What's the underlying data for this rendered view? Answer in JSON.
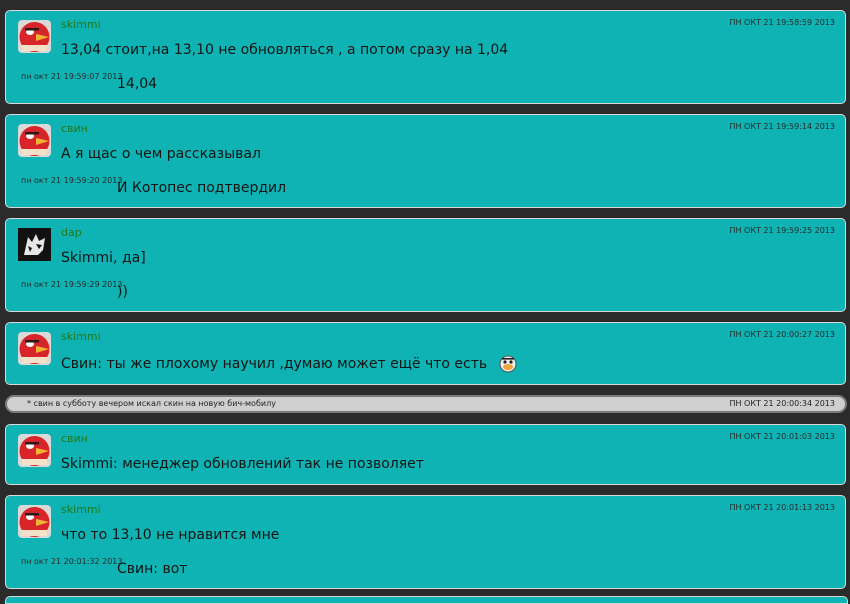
{
  "colors": {
    "card_bg": "#0fb3b3",
    "page_bg": "#2b2b2b",
    "nick": "#1f7a1f"
  },
  "messages": [
    {
      "nick": "skimmi",
      "avatar": "angry-bird-avatar",
      "time": "ПН ОКТ 21 19:58:59 2013",
      "text": "13,04 стоит,на 13,10 не обновляться , а потом сразу на 1,04",
      "extra_time": "пн окт 21 19:59:07 2013",
      "extra_text": "14,04"
    },
    {
      "nick": "свин",
      "avatar": "angry-bird-avatar",
      "time": "ПН ОКТ 21 19:59:14 2013",
      "text": "А я щас о чем рассказывал",
      "extra_time": "пн окт 21 19:59:20 2013",
      "extra_text": "И Котопес подтвердил"
    },
    {
      "nick": "dap",
      "avatar": "wolf-avatar",
      "time": "ПН ОКТ 21 19:59:25 2013",
      "text": "Skimmi, да]",
      "extra_time": "пн окт 21 19:59:29 2013",
      "extra_text": "))"
    },
    {
      "nick": "skimmi",
      "avatar": "angry-bird-avatar",
      "time": "ПН ОКТ 21 20:00:27 2013",
      "text": "Свин:  ты же плохому научил ,думаю может ещё что есть"
    },
    {
      "nick": "свин",
      "avatar": "angry-bird-avatar",
      "time": "ПН ОКТ 21 20:01:03 2013",
      "text": "Skimmi: менеджер обновлений так не позволяет"
    },
    {
      "nick": "skimmi",
      "avatar": "angry-bird-avatar",
      "time": "ПН ОКТ 21 20:01:13 2013",
      "text": "что то 13,10 не нравится мне",
      "extra_time": "пн окт 21 20:01:32 2013",
      "extra_text": "Свин: вот"
    }
  ],
  "action": {
    "text": "* свин в субботу вечером искал скин на новую бич-мобилу",
    "time": "ПН ОКТ 21 20:00:34 2013"
  }
}
